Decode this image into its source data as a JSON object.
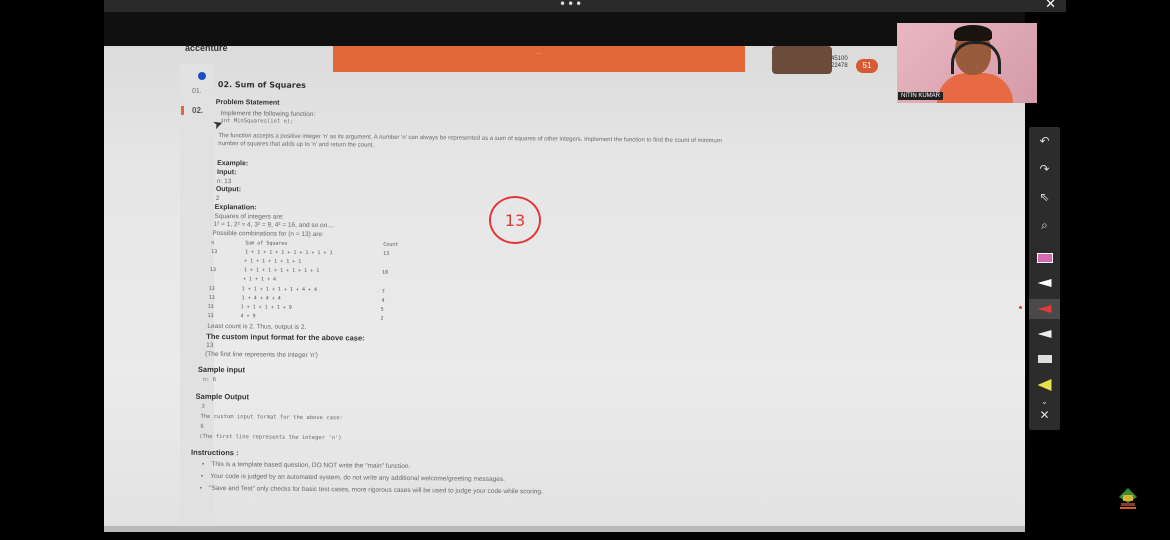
{
  "topbar": {
    "dots": "•••",
    "close": "✕"
  },
  "header": {
    "brand": "accenture",
    "banner": "...",
    "stats_1": "45100",
    "stats_2": "22478",
    "timer": "51"
  },
  "sidebar": {
    "q1": "01.",
    "q2": "02."
  },
  "question": {
    "title": "02. Sum of Squares",
    "problem_heading": "Problem Statement",
    "implement": "Implement the following function:",
    "signature": "int MinSquares(int n);",
    "desc_1": "The function accepts a positive integer 'n' as its argument. A number 'n' can always be represented as a sum of squares of other integers. Implement the function to find the count of minimum",
    "desc_2": "number of squares that adds up to 'n' and return the count.",
    "example": "Example:",
    "input_label": "Input:",
    "input_val": "n: 13",
    "output_label": "Output:",
    "output_val": "2",
    "explanation": "Explanation:",
    "squares_label": "Squares of integers are:",
    "squares_val": "1² = 1, 2² = 4, 3² = 9, 4² = 16, and so on....",
    "combos_label": "Possible combinations for (n = 13) are:",
    "table": {
      "col_n": "n",
      "col_sum": "Sum of Squares",
      "col_count": "Count",
      "rows": [
        {
          "n": "13",
          "sum": "1 + 1 + 1 + 1 + 1 + 1 + 1 + 1",
          "count": "13"
        },
        {
          "n": "",
          "sum": "+ 1 + 1 + 1 + 1 + 1",
          "count": ""
        },
        {
          "n": "13",
          "sum": "1 + 1 + 1 + 1 + 1 + 1 + 1",
          "count": "10"
        },
        {
          "n": "",
          "sum": "+ 1 + 1 + 4",
          "count": ""
        },
        {
          "n": "13",
          "sum": "1 + 1 + 1 + 1 + 1 + 4 + 4",
          "count": "7"
        },
        {
          "n": "13",
          "sum": "1 + 4 + 4 + 4",
          "count": "4"
        },
        {
          "n": "13",
          "sum": "1 + 1 + 1 + 1 + 9",
          "count": "5"
        },
        {
          "n": "13",
          "sum": "4 + 9",
          "count": "2"
        }
      ]
    },
    "least": "Least count is 2. Thus, output is 2.",
    "custom_heading": "The custom input format for the above case:",
    "custom_val": "13",
    "custom_note": "(The first line represents the integer 'n')",
    "sample_input_heading": "Sample input",
    "sample_input_val": "n: 6",
    "sample_output_heading": "Sample Output",
    "sample_output_val": "3",
    "sample_custom": "The custom input format for the above case:",
    "sample_custom_val": "6",
    "sample_custom_note": "(The first line represents the integer 'n')",
    "instructions_heading": "Instructions :",
    "instructions": [
      "This is a template based question, DO NOT write the \"main\" function.",
      "Your code is judged by an automated system, do not write any additional welcome/greeting messages.",
      "\"Save and Test\" only checks for basic test cases, more rigorous cases will be used to judge your code while scoring."
    ]
  },
  "annotation": {
    "circled_number": "13"
  },
  "webcam": {
    "name": "NITIN KUMAR"
  },
  "toolbar": {
    "undo": "↶",
    "redo": "↷",
    "pointer": "⇖",
    "search": "⌕",
    "close": "✕",
    "chevron": "⌄"
  }
}
